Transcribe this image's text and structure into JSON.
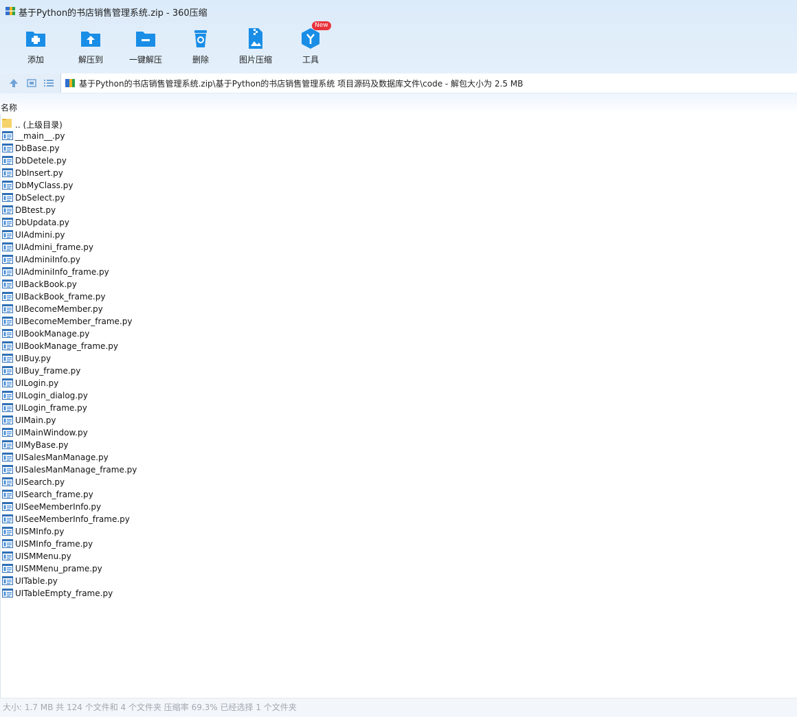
{
  "window": {
    "title": "基于Python的书店销售管理系统.zip - 360压缩"
  },
  "toolbar": {
    "add_label": "添加",
    "extract_to_label": "解压到",
    "one_click_extract_label": "一键解压",
    "delete_label": "删除",
    "image_compress_label": "图片压缩",
    "tools_label": "工具",
    "new_badge": "New"
  },
  "address": {
    "path": "基于Python的书店销售管理系统.zip\\基于Python的书店销售管理系统 项目源码及数据库文件\\code - 解包大小为 2.5 MB"
  },
  "columns": {
    "name": "名称"
  },
  "files": [
    {
      "name": ".. (上级目录)",
      "icon": "folder-icon"
    },
    {
      "name": "__main__.py",
      "icon": "python-file-icon"
    },
    {
      "name": "DbBase.py",
      "icon": "python-file-icon"
    },
    {
      "name": "DbDetele.py",
      "icon": "python-file-icon"
    },
    {
      "name": "DbInsert.py",
      "icon": "python-file-icon"
    },
    {
      "name": "DbMyClass.py",
      "icon": "python-file-icon"
    },
    {
      "name": "DbSelect.py",
      "icon": "python-file-icon"
    },
    {
      "name": "DBtest.py",
      "icon": "python-file-icon"
    },
    {
      "name": "DbUpdata.py",
      "icon": "python-file-icon"
    },
    {
      "name": "UIAdmini.py",
      "icon": "python-file-icon"
    },
    {
      "name": "UIAdmini_frame.py",
      "icon": "python-file-icon"
    },
    {
      "name": "UIAdminiInfo.py",
      "icon": "python-file-icon"
    },
    {
      "name": "UIAdminiInfo_frame.py",
      "icon": "python-file-icon"
    },
    {
      "name": "UIBackBook.py",
      "icon": "python-file-icon"
    },
    {
      "name": "UIBackBook_frame.py",
      "icon": "python-file-icon"
    },
    {
      "name": "UIBecomeMember.py",
      "icon": "python-file-icon"
    },
    {
      "name": "UIBecomeMember_frame.py",
      "icon": "python-file-icon"
    },
    {
      "name": "UIBookManage.py",
      "icon": "python-file-icon"
    },
    {
      "name": "UIBookManage_frame.py",
      "icon": "python-file-icon"
    },
    {
      "name": "UIBuy.py",
      "icon": "python-file-icon"
    },
    {
      "name": "UIBuy_frame.py",
      "icon": "python-file-icon"
    },
    {
      "name": "UILogin.py",
      "icon": "python-file-icon"
    },
    {
      "name": "UILogin_dialog.py",
      "icon": "python-file-icon"
    },
    {
      "name": "UILogin_frame.py",
      "icon": "python-file-icon"
    },
    {
      "name": "UIMain.py",
      "icon": "python-file-icon"
    },
    {
      "name": "UIMainWindow.py",
      "icon": "python-file-icon"
    },
    {
      "name": "UIMyBase.py",
      "icon": "python-file-icon"
    },
    {
      "name": "UISalesManManage.py",
      "icon": "python-file-icon"
    },
    {
      "name": "UISalesManManage_frame.py",
      "icon": "python-file-icon"
    },
    {
      "name": "UISearch.py",
      "icon": "python-file-icon"
    },
    {
      "name": "UISearch_frame.py",
      "icon": "python-file-icon"
    },
    {
      "name": "UISeeMemberInfo.py",
      "icon": "python-file-icon"
    },
    {
      "name": "UISeeMemberInfo_frame.py",
      "icon": "python-file-icon"
    },
    {
      "name": "UISMInfo.py",
      "icon": "python-file-icon"
    },
    {
      "name": "UISMInfo_frame.py",
      "icon": "python-file-icon"
    },
    {
      "name": "UISMMenu.py",
      "icon": "python-file-icon"
    },
    {
      "name": "UISMMenu_prame.py",
      "icon": "python-file-icon"
    },
    {
      "name": "UITable.py",
      "icon": "python-file-icon"
    },
    {
      "name": "UITableEmpty_frame.py",
      "icon": "python-file-icon"
    }
  ],
  "status": {
    "text": "大小: 1.7 MB 共 124 个文件和 4 个文件夹 压缩率 69.3% 已经选择 1 个文件夹"
  },
  "colors": {
    "accent": "#1a8ee6",
    "toolbar_bg": "#dcebfa",
    "status_text": "#a3a9b1"
  }
}
